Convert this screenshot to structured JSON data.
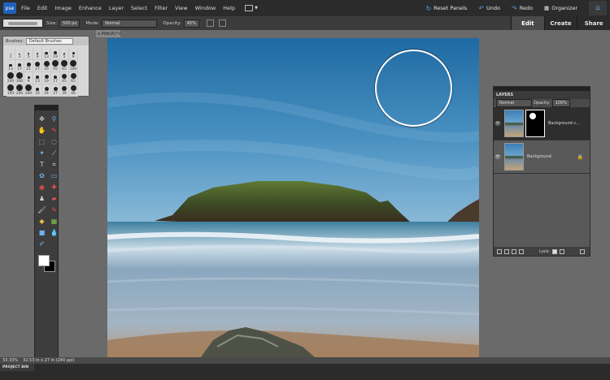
{
  "menubar": {
    "logo": "pse",
    "items": [
      "File",
      "Edit",
      "Image",
      "Enhance",
      "Layer",
      "Select",
      "Filter",
      "View",
      "Window",
      "Help"
    ],
    "reset_panels": "Reset Panels",
    "undo": "Undo",
    "redo": "Redo",
    "organizer": "Organizer"
  },
  "options": {
    "size_label": "Size:",
    "size_value": "500 px",
    "mode_label": "Mode:",
    "mode_value": "Normal",
    "opacity_label": "Opacity:",
    "opacity_value": "45%"
  },
  "mode_tabs": [
    "Edit",
    "Create",
    "Share"
  ],
  "document_tab": {
    "label": "e.Mdb(R)*",
    "close": "×"
  },
  "brush_picker": {
    "label": "Brushes:",
    "set": "Default Brushes",
    "cells": [
      {
        "size": "1",
        "dot": 1
      },
      {
        "size": "3",
        "dot": 1.5
      },
      {
        "size": "5",
        "dot": 2
      },
      {
        "size": "9",
        "dot": 2.5
      },
      {
        "size": "13",
        "dot": 3.5
      },
      {
        "size": "19",
        "dot": 4.5
      },
      {
        "size": "5",
        "dot": 2
      },
      {
        "size": "9",
        "dot": 3
      },
      {
        "size": "13",
        "dot": 3.5
      },
      {
        "size": "17",
        "dot": 4
      },
      {
        "size": "21",
        "dot": 5
      },
      {
        "size": "27",
        "dot": 6
      },
      {
        "size": "35",
        "dot": 7
      },
      {
        "size": "45",
        "dot": 8
      },
      {
        "size": "65",
        "dot": 8
      },
      {
        "size": "100",
        "dot": 8
      },
      {
        "size": "200",
        "dot": 8
      },
      {
        "size": "300",
        "dot": 8
      },
      {
        "size": "9",
        "dot": 3
      },
      {
        "size": "13",
        "dot": 4
      },
      {
        "size": "19",
        "dot": 5
      },
      {
        "size": "17",
        "dot": 4
      },
      {
        "size": "45",
        "dot": 6
      },
      {
        "size": "65",
        "dot": 7
      },
      {
        "size": "100",
        "dot": 8
      },
      {
        "size": "200",
        "dot": 8
      },
      {
        "size": "300",
        "dot": 8
      },
      {
        "size": "14",
        "dot": 4
      },
      {
        "size": "24",
        "dot": 5
      },
      {
        "size": "27",
        "dot": 5
      },
      {
        "size": "39",
        "dot": 6
      },
      {
        "size": "46",
        "dot": 7
      }
    ]
  },
  "layers": {
    "title": "LAYERS",
    "blend_mode": "Normal",
    "opacity_label": "Opacity:",
    "opacity_value": "100%",
    "rows": [
      {
        "name": "Background c...",
        "selected": true,
        "mask": true
      },
      {
        "name": "Background",
        "selected": false,
        "mask": false
      }
    ],
    "lock_label": "Lock:"
  },
  "status": {
    "zoom": "33.33%",
    "info": "32.53 in x 27 in (240 ppi)"
  },
  "project_bin": "PROJECT BIN",
  "colors": {
    "accent": "#5aa0e6",
    "foreground": "#ffffff",
    "background": "#000000"
  }
}
